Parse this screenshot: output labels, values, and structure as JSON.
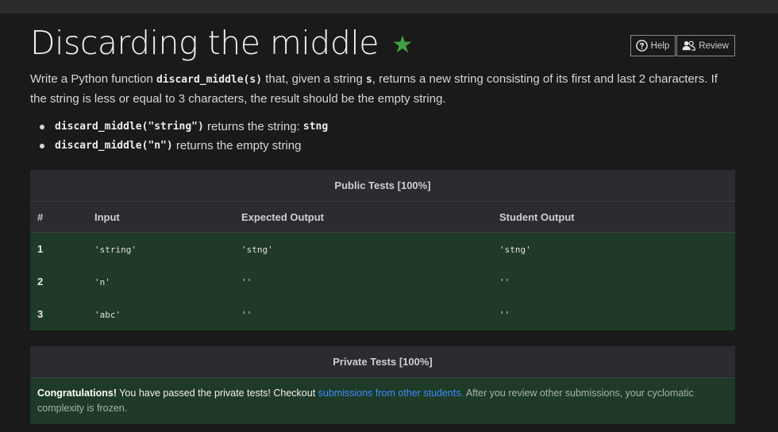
{
  "title": "Discarding the middle",
  "header_buttons": {
    "help": "Help",
    "review": "Review"
  },
  "description": {
    "p1": "Write a Python function ",
    "func_sig": "discard_middle(s)",
    "p2": " that, given a string ",
    "param": "s",
    "p3": ", returns a new string consisting of its first and last 2 characters. If the string is less or equal to 3 characters, the result should be the empty string."
  },
  "examples": [
    {
      "code": "discard_middle(\"string\")",
      "text": " returns the string: ",
      "result": "stng"
    },
    {
      "code": "discard_middle(\"n\")",
      "text": " returns the empty string",
      "result": ""
    }
  ],
  "public_tests": {
    "title": "Public Tests [100%]",
    "columns": [
      "#",
      "Input",
      "Expected Output",
      "Student Output"
    ],
    "rows": [
      {
        "num": "1",
        "input": "'string'",
        "expected": "'stng'",
        "student": "'stng'"
      },
      {
        "num": "2",
        "input": "'n'",
        "expected": "''",
        "student": "''"
      },
      {
        "num": "3",
        "input": "'abc'",
        "expected": "''",
        "student": "''"
      }
    ]
  },
  "private_tests": {
    "title": "Private Tests [100%]",
    "congrats": "Congratulations!",
    "msg1": " You have passed the private tests! Checkout ",
    "link": "submissions from other students.",
    "msg2": " After you review other submissions, your cyclomatic complexity is frozen."
  },
  "colors": {
    "accent_green": "#3fa33f",
    "pass_row": "#1f3a26",
    "link": "#3d8bfd"
  }
}
